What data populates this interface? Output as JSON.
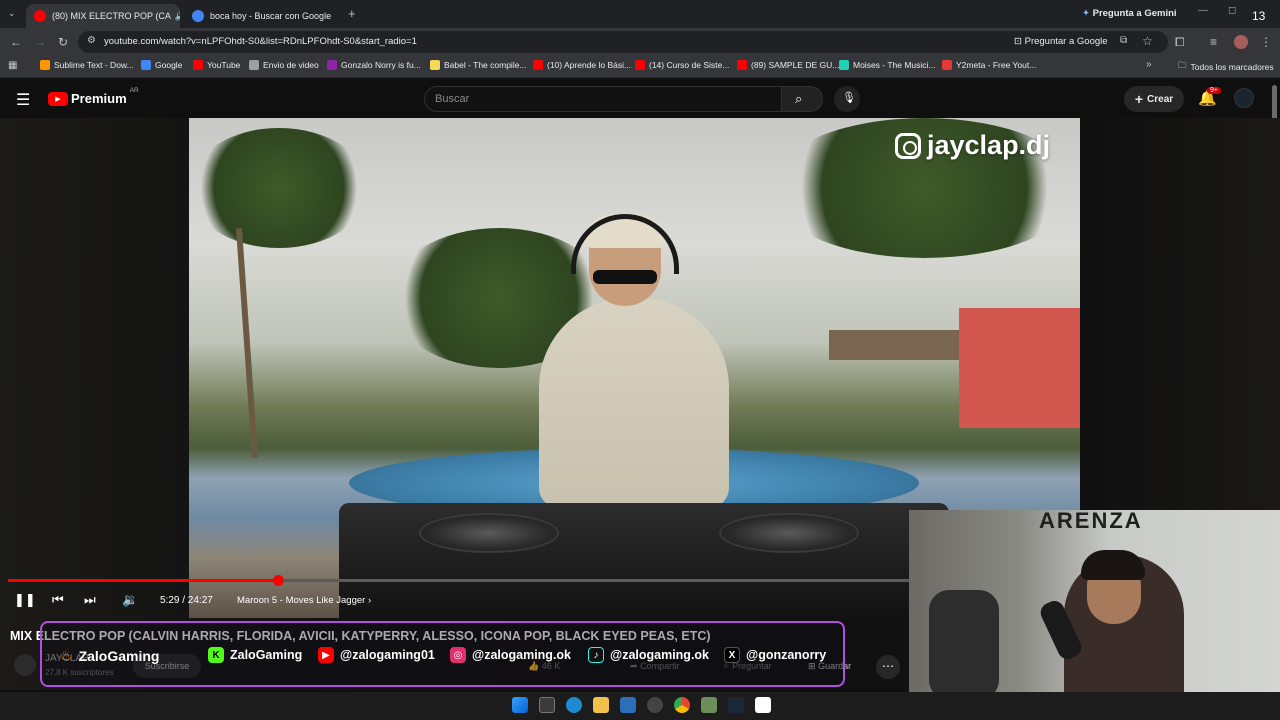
{
  "browser": {
    "tabs": [
      {
        "title": "(80) MIX ELECTRO POP (CA",
        "favicon_color": "#ff0000",
        "active": true
      },
      {
        "title": "boca hoy - Buscar con Google",
        "favicon_color": "#4285f4",
        "active": false
      }
    ],
    "new_tab_glyph": "+",
    "gemini_label": "Pregunta a Gemini",
    "clock_partial": "13",
    "url": "youtube.com/watch?v=nLPFOhdt-S0&list=RDnLPFOhdt-S0&start_radio=1",
    "ask_google_label": "Preguntar a Google",
    "bookmarks": [
      {
        "label": "Sublime Text - Dow...",
        "color": "#ff9800"
      },
      {
        "label": "Google",
        "color": "#4285f4"
      },
      {
        "label": "YouTube",
        "color": "#ff0000"
      },
      {
        "label": "Envio de video",
        "color": "#9aa0a6"
      },
      {
        "label": "Gonzalo Norry is fu...",
        "color": "#8e24aa"
      },
      {
        "label": "Babel - The compile...",
        "color": "#f5da55"
      },
      {
        "label": "(10) Aprende lo Bási...",
        "color": "#ff0000"
      },
      {
        "label": "(14) Curso de Siste...",
        "color": "#ff0000"
      },
      {
        "label": "(89) SAMPLE DE GU...",
        "color": "#ff0000"
      },
      {
        "label": "Moises - The Musici...",
        "color": "#21d0b2"
      },
      {
        "label": "Y2meta - Free Yout...",
        "color": "#e53935"
      }
    ],
    "all_bookmarks_label": "Todos los marcadores"
  },
  "youtube": {
    "logo_text": "Premium",
    "region": "AR",
    "search_placeholder": "Buscar",
    "create_label": "Crear",
    "notifications_badge": "9+",
    "video": {
      "overlay_handle": "jayclap.dj",
      "progress_fraction": 0.216,
      "time": "5:29 / 24:27",
      "chapter": "Maroon 5 - Moves Like Jagger",
      "title": "MIX ELECTRO POP (CALVIN HARRIS, FLORIDA, AVICII, KATYPERRY, ALESSO, ICONA POP, BLACK EYED PEAS, ETC)",
      "channel": "JAYCLAP",
      "subscribers": "27,8 K suscriptores",
      "subscribe_label": "Suscribirse",
      "likes": "46 K",
      "share_label": "Compartir",
      "ask_label": "Preguntar",
      "save_label": "Guardar"
    }
  },
  "banner": {
    "brand": "ZaloGaming",
    "items": [
      {
        "handle": "ZaloGaming",
        "icon": "kick-icon",
        "glyph": "K",
        "color": "#53fc18"
      },
      {
        "handle": "@zalogaming01",
        "icon": "youtube-icon",
        "glyph": "▶",
        "color": "#ff0000"
      },
      {
        "handle": "@zalogaming.ok",
        "icon": "instagram-icon",
        "glyph": "◎",
        "color": "#e1306c"
      },
      {
        "handle": "@zalogaming.ok",
        "icon": "tiktok-icon",
        "glyph": "♪",
        "color": "#25f4ee"
      },
      {
        "handle": "@gonzanorry",
        "icon": "x-icon",
        "glyph": "X",
        "color": "#000000"
      }
    ]
  },
  "webcam": {
    "sign_text": "ARENZA"
  }
}
